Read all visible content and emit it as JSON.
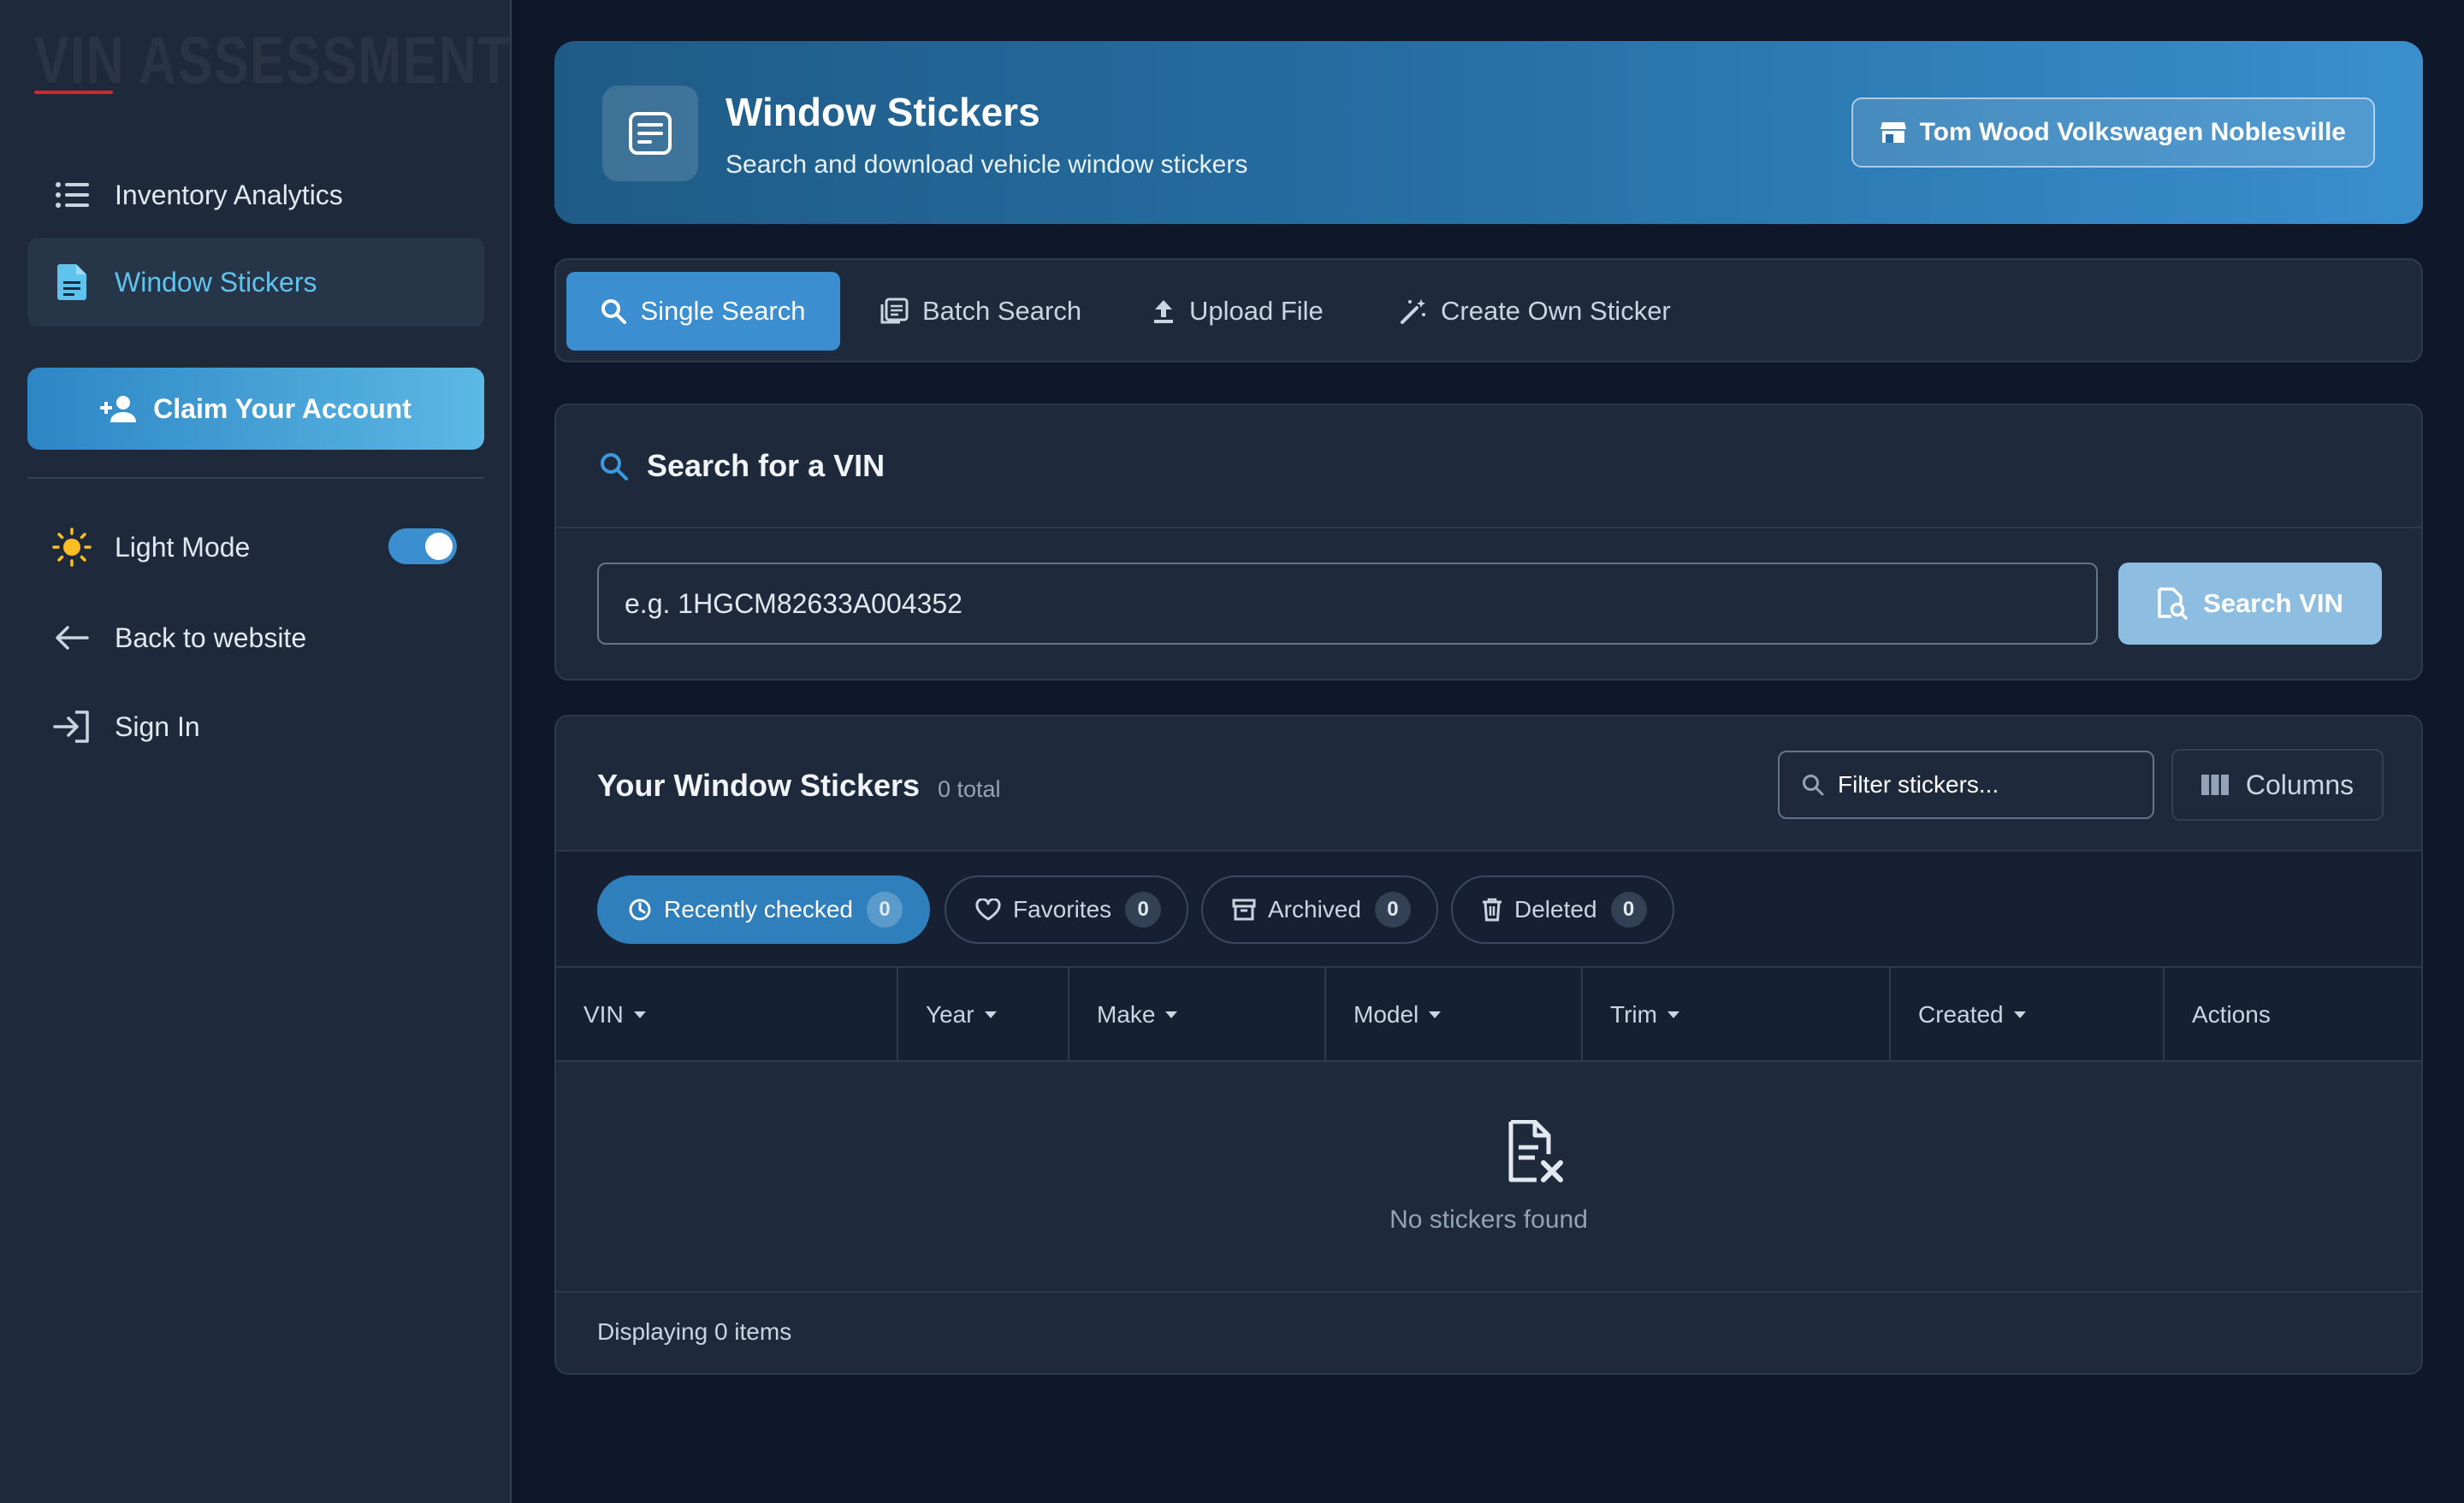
{
  "sidebar": {
    "logo": "VIN ASSESSMENT",
    "nav": [
      {
        "label": "Inventory Analytics",
        "icon": "list-icon"
      },
      {
        "label": "Window Stickers",
        "icon": "document-icon"
      }
    ],
    "claim_label": "Claim Your Account",
    "light_mode_label": "Light Mode",
    "light_mode_on": true,
    "back_label": "Back to website",
    "signin_label": "Sign In"
  },
  "header": {
    "title": "Window Stickers",
    "subtitle": "Search and download vehicle window stickers",
    "dealer": "Tom Wood Volkswagen Noblesville"
  },
  "tabs": [
    {
      "label": "Single Search",
      "icon": "search-icon",
      "active": true
    },
    {
      "label": "Batch Search",
      "icon": "stack-icon",
      "active": false
    },
    {
      "label": "Upload File",
      "icon": "upload-icon",
      "active": false
    },
    {
      "label": "Create Own Sticker",
      "icon": "magic-wand-icon",
      "active": false
    }
  ],
  "search": {
    "title": "Search for a VIN",
    "placeholder": "e.g. 1HGCM82633A004352",
    "button_label": "Search VIN"
  },
  "stickers": {
    "title": "Your Window Stickers",
    "count_label": "0 total",
    "filter_placeholder": "Filter stickers...",
    "columns_label": "Columns",
    "chips": [
      {
        "label": "Recently checked",
        "count": "0",
        "icon": "clock-icon",
        "active": true
      },
      {
        "label": "Favorites",
        "count": "0",
        "icon": "heart-icon",
        "active": false
      },
      {
        "label": "Archived",
        "count": "0",
        "icon": "archive-icon",
        "active": false
      },
      {
        "label": "Deleted",
        "count": "0",
        "icon": "trash-icon",
        "active": false
      }
    ],
    "columns": [
      "VIN",
      "Year",
      "Make",
      "Model",
      "Trim",
      "Created",
      "Actions"
    ],
    "empty_text": "No stickers found",
    "footer": "Displaying 0 items"
  },
  "colors": {
    "background": "#0f172a",
    "sidebar": "#1e293b",
    "accent": "#3b8fd1",
    "active_nav_text": "#60c3ee",
    "logo_underline": "#dc2626"
  }
}
